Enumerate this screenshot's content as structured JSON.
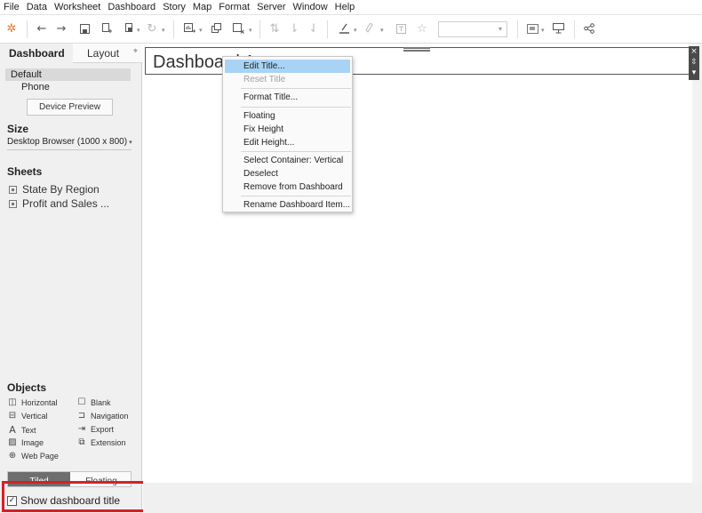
{
  "menu": [
    "File",
    "Data",
    "Worksheet",
    "Dashboard",
    "Story",
    "Map",
    "Format",
    "Server",
    "Window",
    "Help"
  ],
  "toolbar": {
    "icons": [
      "tableau-logo-icon",
      "undo-icon",
      "redo-icon",
      "save-icon",
      "new-datasource-icon",
      "pause-updates-icon",
      "refresh-icon",
      "new-worksheet-icon",
      "duplicate-icon",
      "clear-sheet-icon",
      "swap-icon",
      "sort-ascending-icon",
      "sort-descending-icon",
      "highlight-icon",
      "group-icon",
      "labels-icon",
      "fix-axes-icon",
      "fit-select",
      "show-cards-icon",
      "presentation-icon",
      "share-icon"
    ],
    "fit_value": ""
  },
  "left_panel": {
    "tabs": {
      "dashboard": "Dashboard",
      "layout": "Layout"
    },
    "devices": {
      "default": "Default",
      "phone": "Phone"
    },
    "device_preview_label": "Device Preview",
    "size": {
      "title": "Size",
      "value": "Desktop Browser (1000 x 800)"
    },
    "sheets": {
      "title": "Sheets",
      "items": [
        "State By Region",
        "Profit and Sales ..."
      ]
    },
    "objects": {
      "title": "Objects",
      "items": [
        {
          "label": "Horizontal",
          "icon": "horizontal-container-icon"
        },
        {
          "label": "Blank",
          "icon": "blank-icon"
        },
        {
          "label": "Vertical",
          "icon": "vertical-container-icon"
        },
        {
          "label": "Navigation",
          "icon": "navigation-icon"
        },
        {
          "label": "Text",
          "icon": "text-icon"
        },
        {
          "label": "Export",
          "icon": "export-icon"
        },
        {
          "label": "Image",
          "icon": "image-icon"
        },
        {
          "label": "Extension",
          "icon": "extension-icon"
        },
        {
          "label": "Web Page",
          "icon": "web-page-icon"
        }
      ]
    },
    "tiled_label": "Tiled",
    "floating_label": "Floating",
    "show_title_label": "Show dashboard title",
    "show_title_checked": true
  },
  "canvas": {
    "title_text": "Dashboard 1"
  },
  "context_menu": {
    "items": [
      {
        "label": "Edit Title...",
        "state": "highlighted"
      },
      {
        "label": "Reset Title",
        "state": "disabled"
      },
      {
        "label": "Format Title...",
        "state": "normal"
      },
      {
        "label": "Floating",
        "state": "normal"
      },
      {
        "label": "Fix Height",
        "state": "normal"
      },
      {
        "label": "Edit Height...",
        "state": "normal"
      },
      {
        "label": "Select Container: Vertical",
        "state": "normal"
      },
      {
        "label": "Deselect",
        "state": "normal"
      },
      {
        "label": "Remove from Dashboard",
        "state": "normal"
      },
      {
        "label": "Rename Dashboard Item...",
        "state": "normal"
      }
    ]
  },
  "colors": {
    "highlight_box": "#d61f26",
    "menu_highlight": "#a8d3f4",
    "tiled_active": "#6e6e6e"
  }
}
